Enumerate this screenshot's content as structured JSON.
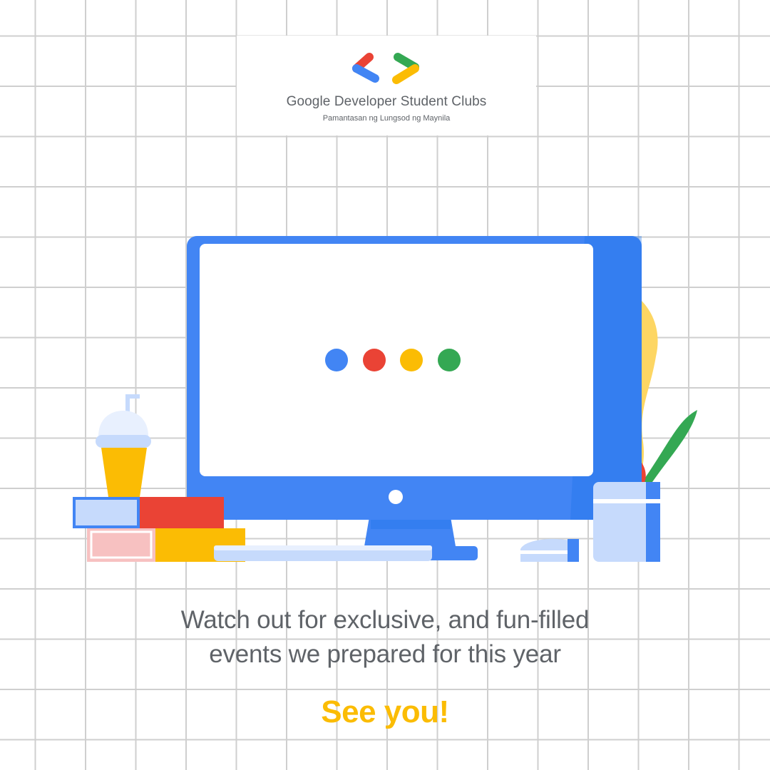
{
  "brand": {
    "title": "Google Developer Student Clubs",
    "subtitle": "Pamantasan ng Lungsod ng Maynila",
    "logo_icon": "gdsc-brackets-icon"
  },
  "illustration": {
    "icons": [
      "monitor-icon",
      "loading-dots-icon",
      "plant-icon",
      "cup-icon",
      "books-icon",
      "keyboard-icon",
      "mouse-icon",
      "pot-icon"
    ]
  },
  "message": {
    "line1": "Watch out for exclusive, and fun-filled",
    "line2": "events we prepared for this year"
  },
  "cta": "See you!",
  "colors": {
    "blue": "#4285f4",
    "red": "#ea4335",
    "yellow": "#fbbc04",
    "green": "#34a853",
    "text_gray": "#5f6368"
  }
}
